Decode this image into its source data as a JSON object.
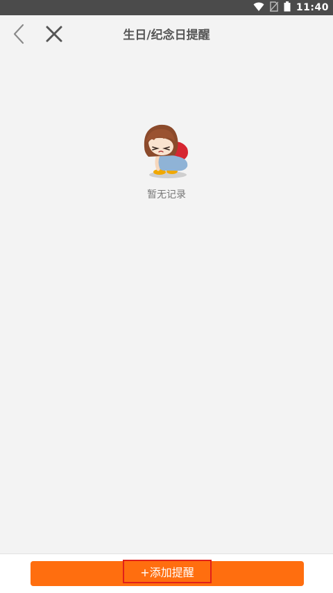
{
  "status_bar": {
    "time": "11:40",
    "icons": [
      "wifi-icon",
      "no-sim-icon",
      "battery-icon"
    ]
  },
  "header": {
    "title": "生日/纪念日提醒",
    "back_icon": "chevron-left-icon",
    "close_icon": "close-icon"
  },
  "empty_state": {
    "illustration": "sad-girl-illustration",
    "message": "暂无记录"
  },
  "bottom": {
    "add_label": "+添加提醒"
  },
  "colors": {
    "status_bar_bg": "#4b4b4b",
    "page_bg": "#f3f3f3",
    "accent": "#ff6e0f",
    "highlight_border": "#e0201a",
    "title_text": "#555555"
  }
}
